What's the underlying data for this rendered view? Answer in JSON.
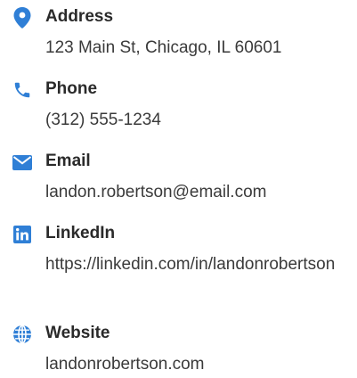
{
  "accent_color": "#2f7fd6",
  "items": [
    {
      "icon": "map-pin-icon",
      "label": "Address",
      "value": "123 Main St, Chicago, IL 60601"
    },
    {
      "icon": "phone-icon",
      "label": "Phone",
      "value": "(312) 555-1234"
    },
    {
      "icon": "envelope-icon",
      "label": "Email",
      "value": "landon.robertson@email.com"
    },
    {
      "icon": "linkedin-icon",
      "label": "LinkedIn",
      "value": "https://linkedin.com/in/landonrobertson"
    },
    {
      "icon": "globe-icon",
      "label": "Website",
      "value": "landonrobertson.com"
    }
  ]
}
